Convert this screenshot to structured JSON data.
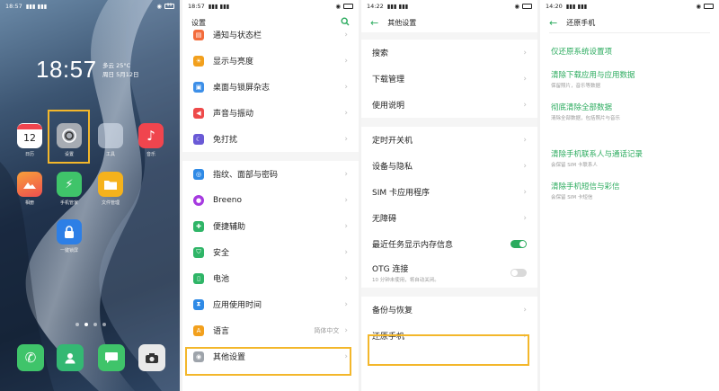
{
  "home": {
    "status_time": "18:57",
    "clock": "18:57",
    "weather_line1": "多云 25°C",
    "weather_line2": "周日 5月12日",
    "battery": "99",
    "apps": [
      {
        "label": "日历",
        "icon": "calendar-icon",
        "badge": "12",
        "color": "#ffffff"
      },
      {
        "label": "设置",
        "icon": "settings-icon",
        "color": "#9aa0a8"
      },
      {
        "label": "工具",
        "icon": "tools-folder-icon",
        "color": "#c9d3e3"
      },
      {
        "label": "音乐",
        "icon": "music-icon",
        "color": "#f0454e"
      },
      {
        "label": "相册",
        "icon": "photos-icon",
        "color": "#f27b3a"
      },
      {
        "label": "手机管家",
        "icon": "phone-manager-icon",
        "color": "#3fc46a"
      },
      {
        "label": "文件管理",
        "icon": "file-manager-icon",
        "color": "#f5b21c"
      },
      {
        "label": "一键锁屏",
        "icon": "lock-icon",
        "color": "#2d7fe6"
      }
    ],
    "dock": [
      {
        "icon": "phone-icon",
        "color": "#3fc46a"
      },
      {
        "icon": "contacts-icon",
        "color": "#34b873"
      },
      {
        "icon": "messages-icon",
        "color": "#3fc46a"
      },
      {
        "icon": "camera-icon",
        "color": "#e9e9e9"
      }
    ]
  },
  "settings": {
    "status_time": "18:57",
    "title": "设置",
    "rows": [
      {
        "label": "通知与状态栏",
        "icon": "notification-icon",
        "color": "#f36b3b"
      },
      {
        "label": "显示与亮度",
        "icon": "display-icon",
        "color": "#f2a01d"
      },
      {
        "label": "桌面与锁屏杂志",
        "icon": "wallpaper-icon",
        "color": "#3d8fe8"
      },
      {
        "label": "声音与振动",
        "icon": "sound-icon",
        "color": "#ee4a4a"
      },
      {
        "label": "免打扰",
        "icon": "moon-icon",
        "color": "#6a5ad6"
      }
    ],
    "rows2": [
      {
        "label": "指纹、面部与密码",
        "icon": "fingerprint-icon",
        "color": "#2f8ae6"
      },
      {
        "label": "Breeno",
        "icon": "breeno-icon",
        "color": "#a63ae0"
      },
      {
        "label": "便捷辅助",
        "icon": "assist-icon",
        "color": "#2fb567"
      },
      {
        "label": "安全",
        "icon": "shield-icon",
        "color": "#2fb567"
      },
      {
        "label": "电池",
        "icon": "battery-icon",
        "color": "#2fb567"
      },
      {
        "label": "应用使用时间",
        "icon": "hourglass-icon",
        "color": "#2f8ae6"
      },
      {
        "label": "语言",
        "icon": "language-icon",
        "color": "#f2a01d",
        "value": "简体中文"
      },
      {
        "label": "其他设置",
        "icon": "other-settings-icon",
        "color": "#9ea4ab"
      }
    ]
  },
  "other": {
    "status_time": "14:22",
    "title": "其他设置",
    "group1": [
      "搜索",
      "下载管理",
      "使用说明"
    ],
    "group2": [
      "定时开关机",
      "设备与隐私",
      "SIM 卡应用程序",
      "无障碍"
    ],
    "recent_tasks_label": "最近任务显示内存信息",
    "otg_label": "OTG 连接",
    "otg_sub": "10 分钟未使用，将自动关闭。",
    "group3": [
      "备份与恢复",
      "还原手机"
    ]
  },
  "reset": {
    "status_time": "14:20",
    "title": "还原手机",
    "options": [
      {
        "title": "仅还原系统设置项",
        "sub": ""
      },
      {
        "title": "清除下载应用与应用数据",
        "sub": "保留照片，音乐等数据"
      },
      {
        "title": "彻底清除全部数据",
        "sub": "清除全部数据，包括照片与音乐"
      },
      {
        "title": "清除手机联系人与通话记录",
        "sub": "会保留 SIM 卡联系人"
      },
      {
        "title": "清除手机短信与彩信",
        "sub": "会保留 SIM 卡短信"
      }
    ]
  }
}
